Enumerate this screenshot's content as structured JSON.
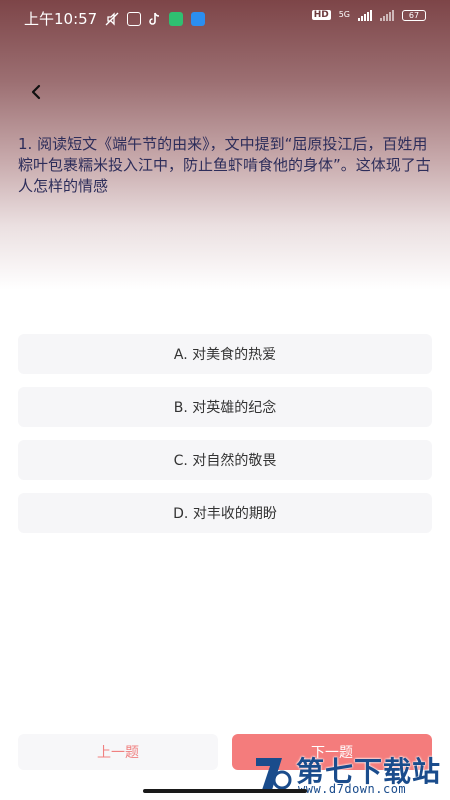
{
  "status_bar": {
    "time": "上午10:57",
    "hd": "HD",
    "network": "5G",
    "battery": "67"
  },
  "question": {
    "text": "1. 阅读短文《端午节的由来》，文中提到“屈原投江后，百姓用粽叶包裹糯米投入江中，防止鱼虾啃食他的身体”。这体现了古人怎样的情感"
  },
  "options": [
    {
      "label": "A. 对美食的热爱"
    },
    {
      "label": "B. 对英雄的纪念"
    },
    {
      "label": "C. 对自然的敬畏"
    },
    {
      "label": "D. 对丰收的期盼"
    }
  ],
  "footer": {
    "prev_label": "上一题",
    "next_label": "下一题"
  },
  "watermark": {
    "title": "第七下载站",
    "url": "www.d7down.com"
  },
  "colors": {
    "accent": "#f47c7c",
    "question_text": "#2d2d5a",
    "header_top": "#7d4548"
  },
  "icons": {
    "back": "chevron-left-icon"
  }
}
